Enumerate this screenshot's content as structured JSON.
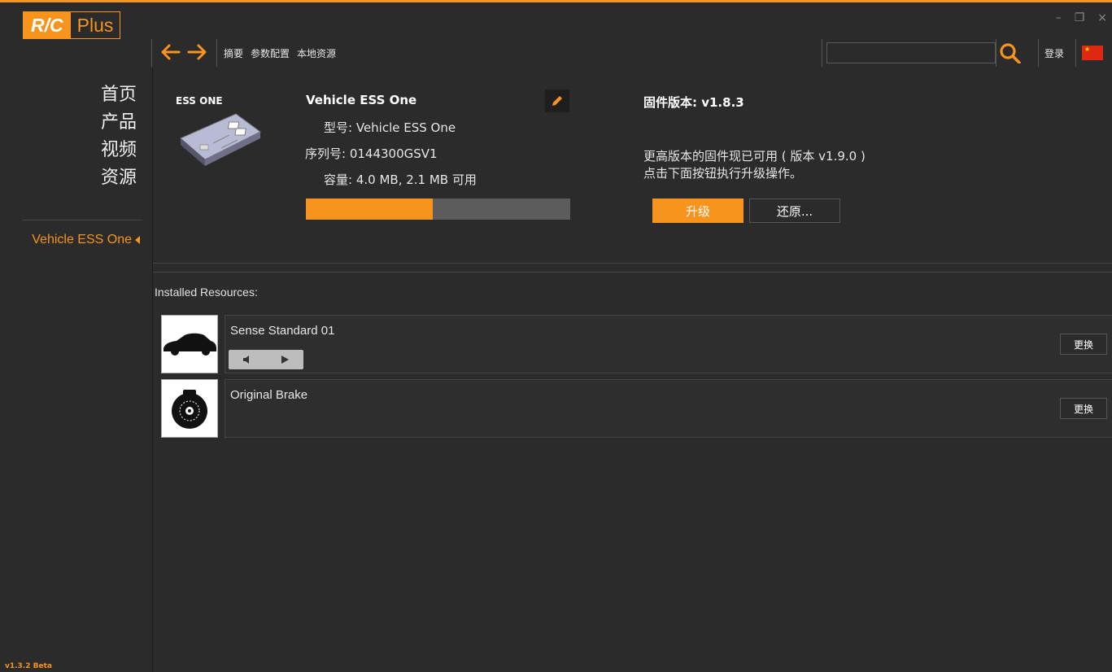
{
  "app": {
    "logo_rc": "R/C",
    "logo_plus": "Plus",
    "version": "v1.3.2 Beta",
    "accent_color": "#f7941d"
  },
  "window_controls": {
    "minimize": "–",
    "restore": "❐",
    "close": "×"
  },
  "sidebar": {
    "items": [
      {
        "label": "首页"
      },
      {
        "label": "产品"
      },
      {
        "label": "视频"
      },
      {
        "label": "资源"
      }
    ],
    "device_link": "Vehicle ESS One"
  },
  "toolbar": {
    "back_icon": "arrow-left-icon",
    "forward_icon": "arrow-right-icon",
    "breadcrumbs": [
      "摘要",
      "参数配置",
      "本地资源"
    ],
    "search": {
      "value": "",
      "placeholder": ""
    },
    "search_icon": "search-icon",
    "login_label": "登录",
    "flag_icon": "china-flag-icon"
  },
  "device": {
    "tag": "ESS ONE",
    "name": "Vehicle ESS One",
    "model_label": "型号:",
    "model_value": "Vehicle ESS One",
    "serial_label": "序列号:",
    "serial_value": "0144300GSV1",
    "capacity_label": "容量:",
    "capacity_value": "4.0 MB, 2.1 MB 可用",
    "capacity_used_fraction": 0.48
  },
  "firmware": {
    "version_text": "固件版本: v1.8.3",
    "message_line1": "更高版本的固件现已可用 ( 版本 v1.9.0 )",
    "message_line2": "点击下面按钮执行升级操作。",
    "upgrade_label": "升级",
    "restore_label": "还原..."
  },
  "resources": {
    "heading": "Installed Resources:",
    "items": [
      {
        "name": "Sense Standard 01",
        "change_label": "更换",
        "icon": "car-silhouette-icon"
      },
      {
        "name": "Original Brake",
        "change_label": "更换",
        "icon": "brake-disc-icon"
      }
    ]
  }
}
